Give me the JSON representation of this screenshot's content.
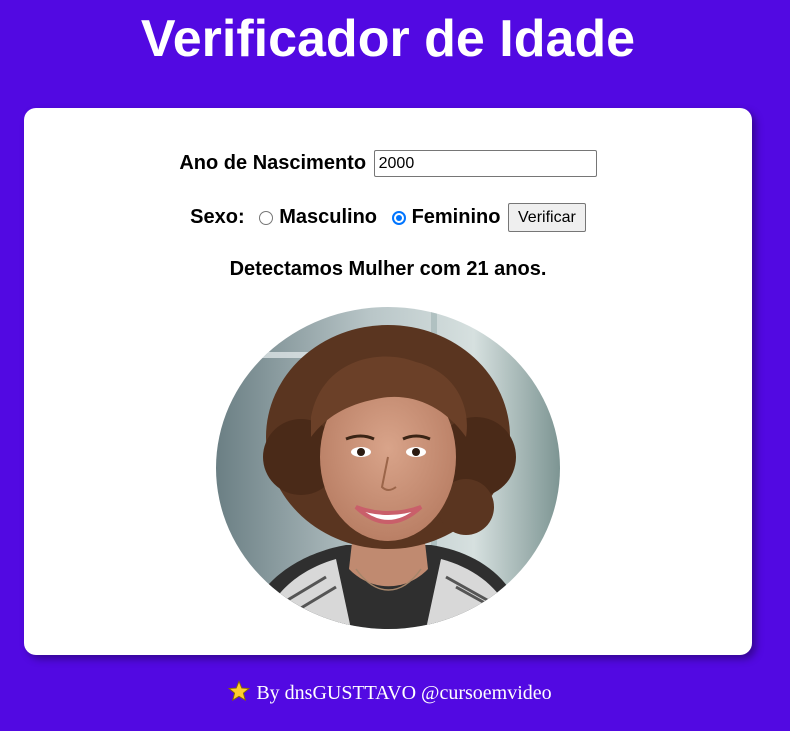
{
  "header": {
    "title": "Verificador de Idade"
  },
  "form": {
    "year_label": "Ano de Nascimento",
    "year_value": "2000",
    "sex_label": "Sexo:",
    "options": [
      {
        "label": "Masculino",
        "checked": false
      },
      {
        "label": "Feminino",
        "checked": true
      }
    ],
    "verify_button": "Verificar"
  },
  "result": {
    "message": "Detectamos Mulher com 21 anos.",
    "photo_icon": "woman-portrait"
  },
  "footer": {
    "icon": "star-icon",
    "text": "By dnsGUSTTAVO @cursoemvideo"
  },
  "colors": {
    "background": "#5209e2",
    "card": "#ffffff",
    "radio_accent": "#0075ff",
    "star": "#ffcc2e"
  }
}
